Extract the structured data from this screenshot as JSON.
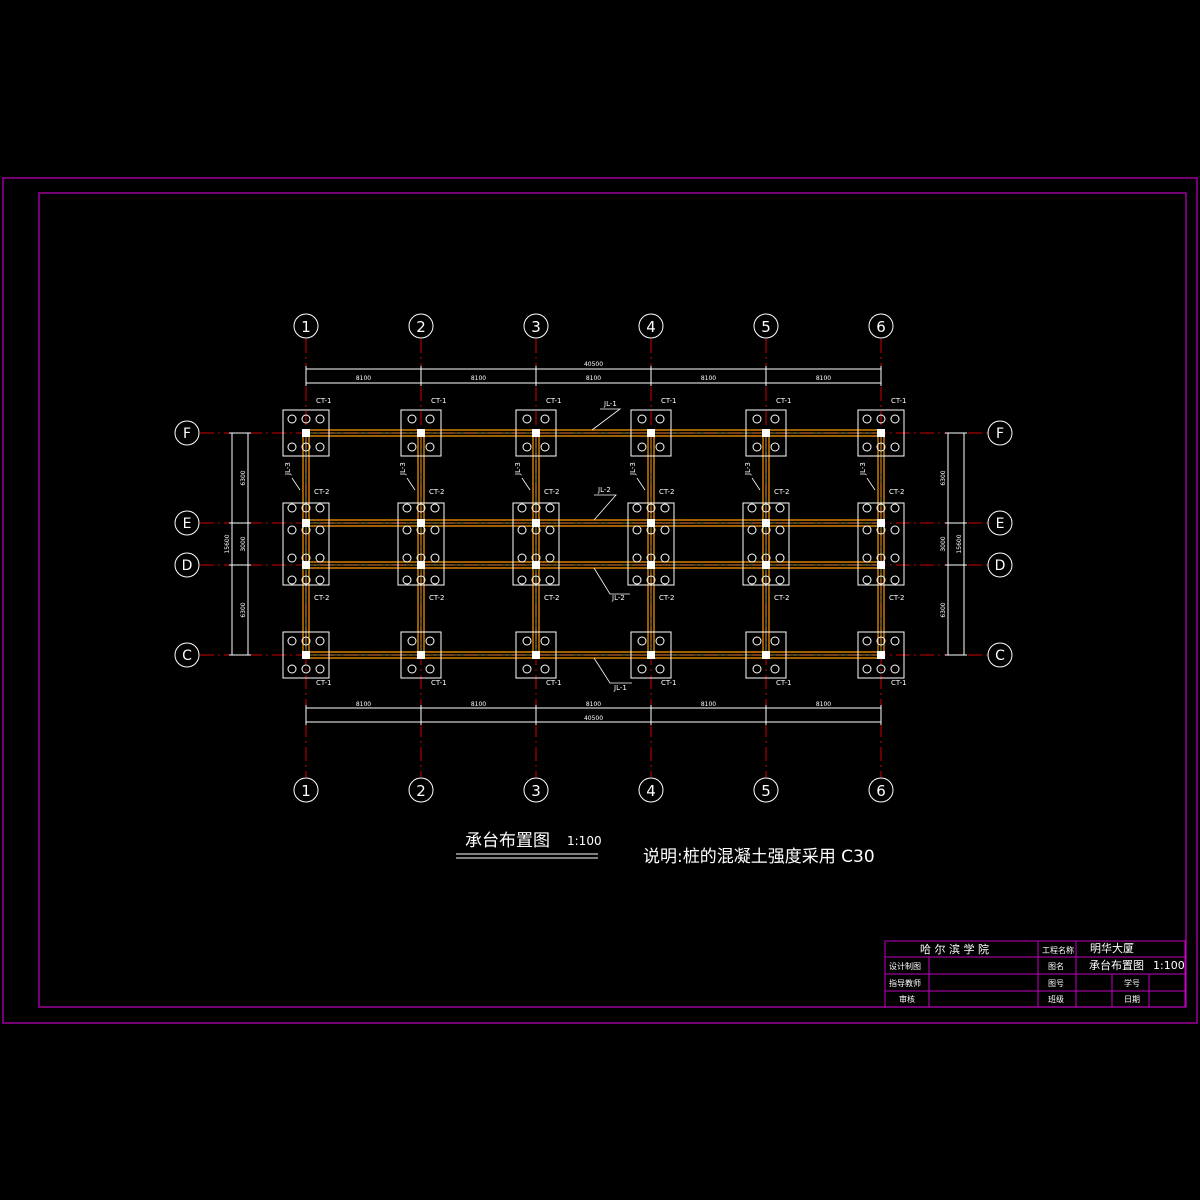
{
  "grid": {
    "columns": [
      "1",
      "2",
      "3",
      "4",
      "5",
      "6"
    ],
    "rows": [
      "F",
      "E",
      "D",
      "C"
    ],
    "spans_x": [
      "8100",
      "8100",
      "8100",
      "8100",
      "8100"
    ],
    "total_x": "40500",
    "spans_y": [
      "6300",
      "3000",
      "6300"
    ],
    "total_y": "15600"
  },
  "labels": {
    "ct1": "CT-1",
    "ct2": "CT-2",
    "jl1": "JL-1",
    "jl2": "JL-2",
    "jl3": "JL-3"
  },
  "drawing": {
    "title": "承台布置图",
    "scale": "1:100",
    "note": "说明:桩的混凝土强度采用 C30"
  },
  "title_block": {
    "school": "哈 尔 滨 学 院",
    "project_label": "工程名称",
    "project_value": "明华大厦",
    "drawing_name_label": "图名",
    "drawing_name_value": "承台布置图",
    "drawing_scale": "1:100",
    "designer_label": "设计制图",
    "advisor_label": "指导教师",
    "reviewer_label": "审核",
    "drawing_no_label": "图号",
    "student_no_label": "学号",
    "class_label": "班级",
    "date_label": "日期"
  },
  "colors": {
    "background": "#000000",
    "frame": "#c000c0",
    "axis": "#d00000",
    "beam": "#ff9900",
    "beam_inner": "#ffff66",
    "line": "#ffffff"
  }
}
